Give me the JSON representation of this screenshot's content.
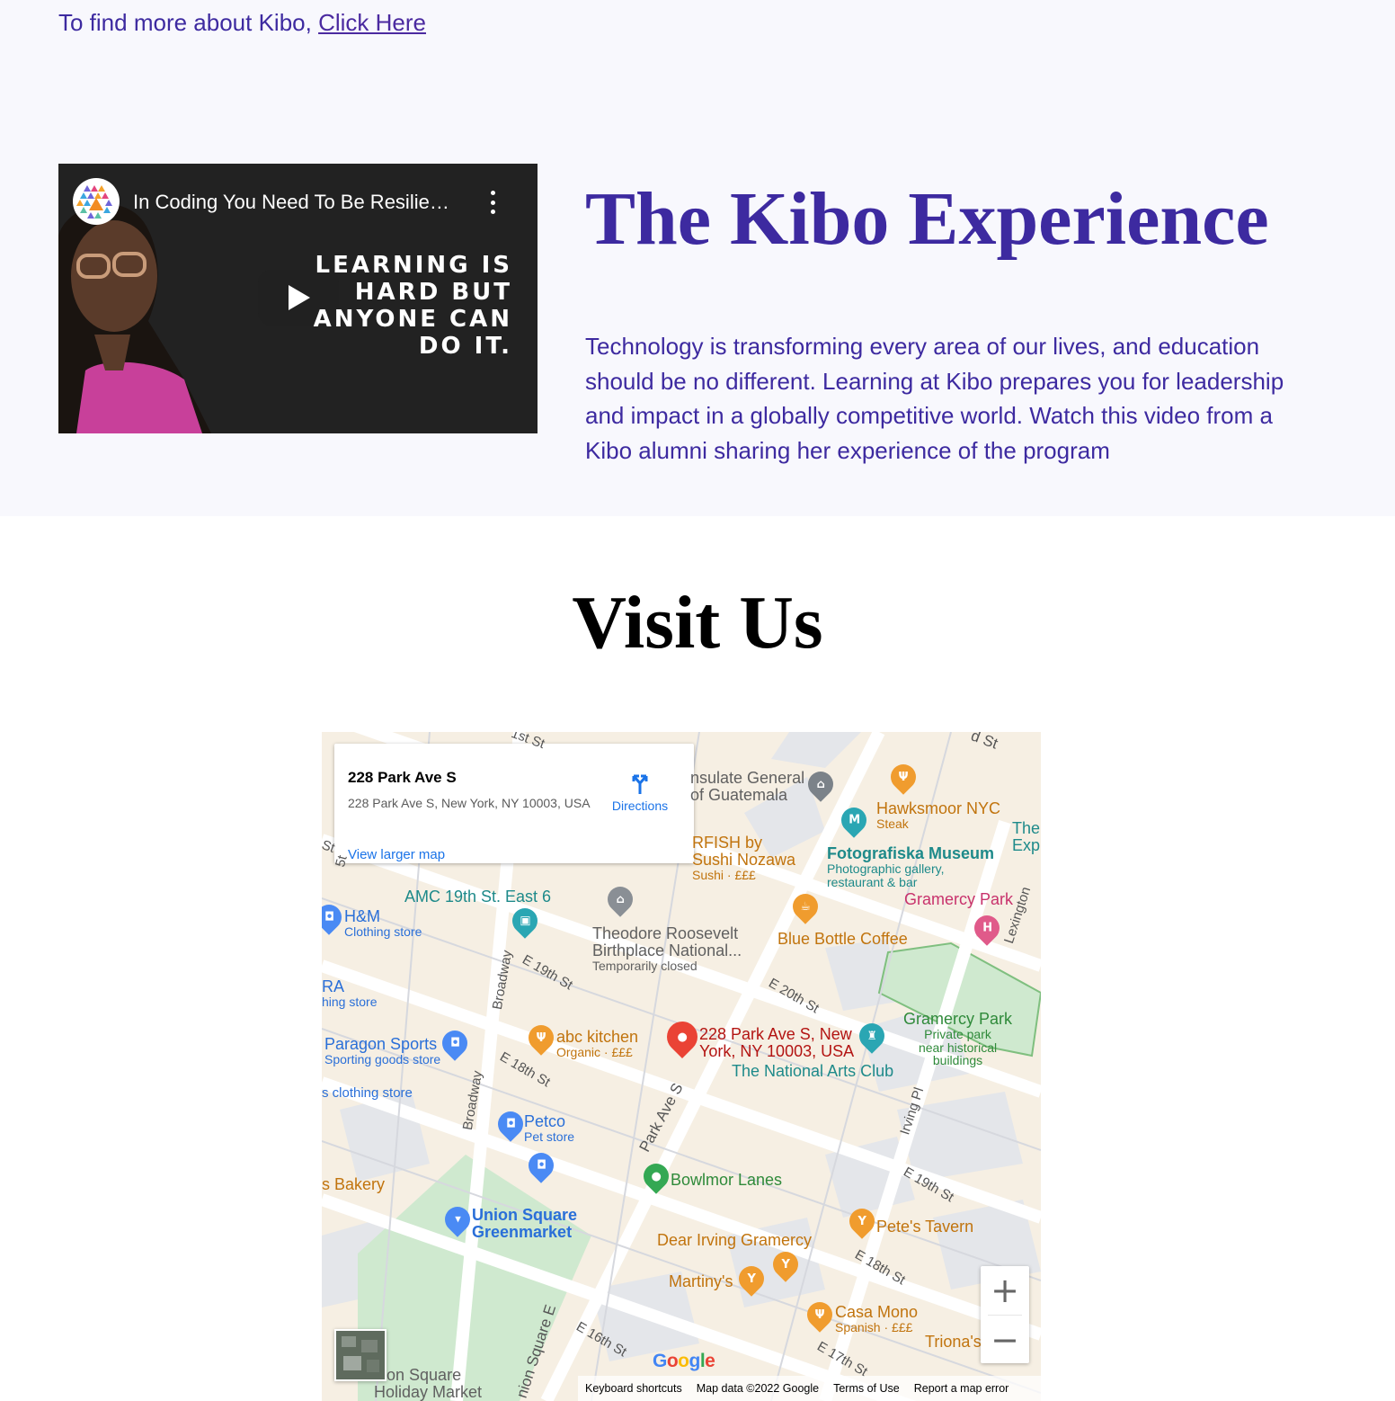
{
  "intro": {
    "text": "To find more about Kibo, ",
    "link": "Click Here"
  },
  "video": {
    "title": "In Coding You Need To Be Resilie…",
    "overlay_lines": [
      "LEARNING IS",
      "HARD BUT",
      "ANYONE CAN",
      "DO IT."
    ]
  },
  "experience": {
    "title": "The Kibo Experience",
    "description": "Technology is transforming every area of our lives, and education should be no different. Learning at Kibo prepares you for leadership and impact in a globally competitive world. Watch this video from a Kibo alumni sharing her experience of the program"
  },
  "visit": {
    "title": "Visit Us"
  },
  "map": {
    "card": {
      "title": "228 Park Ave S",
      "address": "228 Park Ave S, New York, NY 10003, USA",
      "directions": "Directions",
      "larger_map": "View larger map"
    },
    "places": {
      "consulate": "nsulate General\nof Guatemala",
      "hawksmoor": "Hawksmoor NYC",
      "hawksmoor_sub": "Steak",
      "the_exp": "The\nExp",
      "starfish": "RFISH by\nSushi Nozawa",
      "starfish_sub": "Sushi · £££",
      "fotografiska": "Fotografiska Museum",
      "fotografiska_sub": "Photographic gallery,\nrestaurant & bar",
      "gramercy_park_hotel": "Gramercy Park",
      "amc": "AMC 19th St. East 6",
      "hm": "H&M",
      "hm_sub": "Clothing store",
      "roosevelt": "Theodore Roosevelt\nBirthplace National...",
      "roosevelt_sub": "Temporarily closed",
      "blue_bottle": "Blue Bottle Coffee",
      "zara_a": "RA",
      "zara_b": "hing store",
      "paragon": "Paragon Sports",
      "paragon_sub": "Sporting goods store",
      "abc_kitchen": "abc kitchen",
      "abc_sub": "Organic · £££",
      "pin_label": "228 Park Ave S, New\nYork, NY 10003, USA",
      "national_arts": "The National Arts Club",
      "gramercy_park": "Gramercy Park",
      "gramercy_sub": "Private park\nnear historical\nbuildings",
      "clothing": "s clothing store",
      "petco": "Petco",
      "petco_sub": "Pet store",
      "bakery": "s Bakery",
      "bowlmor": "Bowlmor Lanes",
      "greenmarket": "Union Square\nGreenmarket",
      "petes": "Pete's Tavern",
      "dear_irving": "Dear Irving Gramercy",
      "martinys": "Martiny's",
      "casa_mono": "Casa Mono",
      "casa_sub": "Spanish · £££",
      "trionas": "Triona's",
      "union_square": "nion Square\nHoliday Market"
    },
    "streets": {
      "st1": "1st St",
      "st2": "d St",
      "e19a": "E 19th St",
      "e20": "E 20th St",
      "e18a": "E 18th St",
      "broadway1": "Broadway",
      "broadway2": "Broadway",
      "park_ave": "Park Ave S",
      "irving": "Irving Pl",
      "lexington": "Lexington",
      "e19b": "E 19th St",
      "e18b": "E 18th St",
      "e17": "E 17th St",
      "e16": "E 16th St",
      "union_sq_e": "nion Square E",
      "st_left": "St",
      "fifth": "5t"
    },
    "google": "Google",
    "footer": [
      "Keyboard shortcuts",
      "Map data ©2022 Google",
      "Terms of Use",
      "Report a map error"
    ],
    "zoom_in": "+",
    "zoom_out": "−"
  },
  "colors": {
    "brand": "#3d2aa0",
    "section_bg": "#f8f8fd",
    "pin_red": "#ea4335"
  }
}
